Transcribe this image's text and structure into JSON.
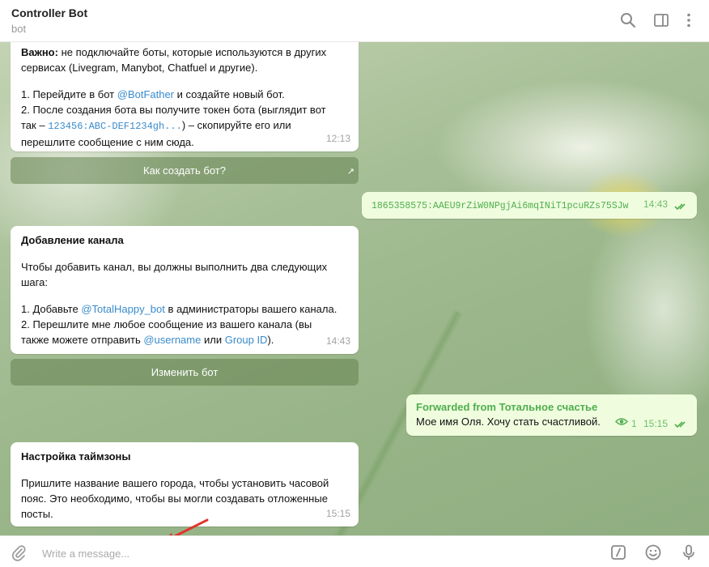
{
  "header": {
    "title": "Controller Bot",
    "subtitle": "bot",
    "icons": [
      "search-icon",
      "sidebar-toggle-icon",
      "more-vertical-icon"
    ]
  },
  "messages": {
    "m1": {
      "line1_bold": "Важно:",
      "line1": " не подключайте боты, которые используются в других",
      "line2": "сервисах (Livegram, Manybot, Chatfuel и другие).",
      "line3a": "1. Перейдите в бот ",
      "line3_link": "@BotFather",
      "line3b": " и создайте новый бот.",
      "line4": "2. После создания бота вы получите токен бота (выглядит вот",
      "line5a": "так – ",
      "line5_code": "123456:ABC-DEF1234gh...",
      "line5b": ") – скопируйте его или",
      "line6": "перешлите сообщение с ним сюда.",
      "time": "12:13",
      "button": "Как создать бот?"
    },
    "m2": {
      "token": "1865358575:AAEU9rZiW0NPgjAi6mqINiT1pcuRZs75SJw",
      "time": "14:43"
    },
    "m3": {
      "heading": "Добавление канала",
      "line1": "Чтобы добавить канал, вы должны выполнить два следующих",
      "line2": "шага:",
      "line3a": "1. Добавьте ",
      "line3_link": "@TotalHappy_bot",
      "line3b": " в администраторы вашего канала.",
      "line4": "2. Перешлите мне любое сообщение из вашего канала (вы",
      "line5a": "также можете отправить ",
      "line5_link1": "@username",
      "line5_mid": " или ",
      "line5_link2": "Group ID",
      "line5b": ").",
      "time": "14:43",
      "button": "Изменить бот"
    },
    "m4": {
      "forwarded": "Forwarded from Тотальное счастье",
      "text": "Мое имя Оля. Хочу стать счастливой.",
      "views": "1",
      "time": "15:15"
    },
    "m5": {
      "heading": "Настройка таймзоны",
      "line1": "Пришлите название вашего города, чтобы установить часовой",
      "line2": "пояс. Это необходимо, чтобы вы могли создавать отложенные",
      "line3": "посты.",
      "time": "15:15"
    }
  },
  "composer": {
    "placeholder": "Write a message...",
    "icons": [
      "paperclip-icon",
      "bot-command-icon",
      "emoji-icon",
      "microphone-icon"
    ]
  },
  "colors": {
    "link": "#3a8bcb",
    "outgoing_bubble": "#effdde",
    "outgoing_accent": "#4fae4e",
    "annotation_arrow": "#e2332a"
  }
}
